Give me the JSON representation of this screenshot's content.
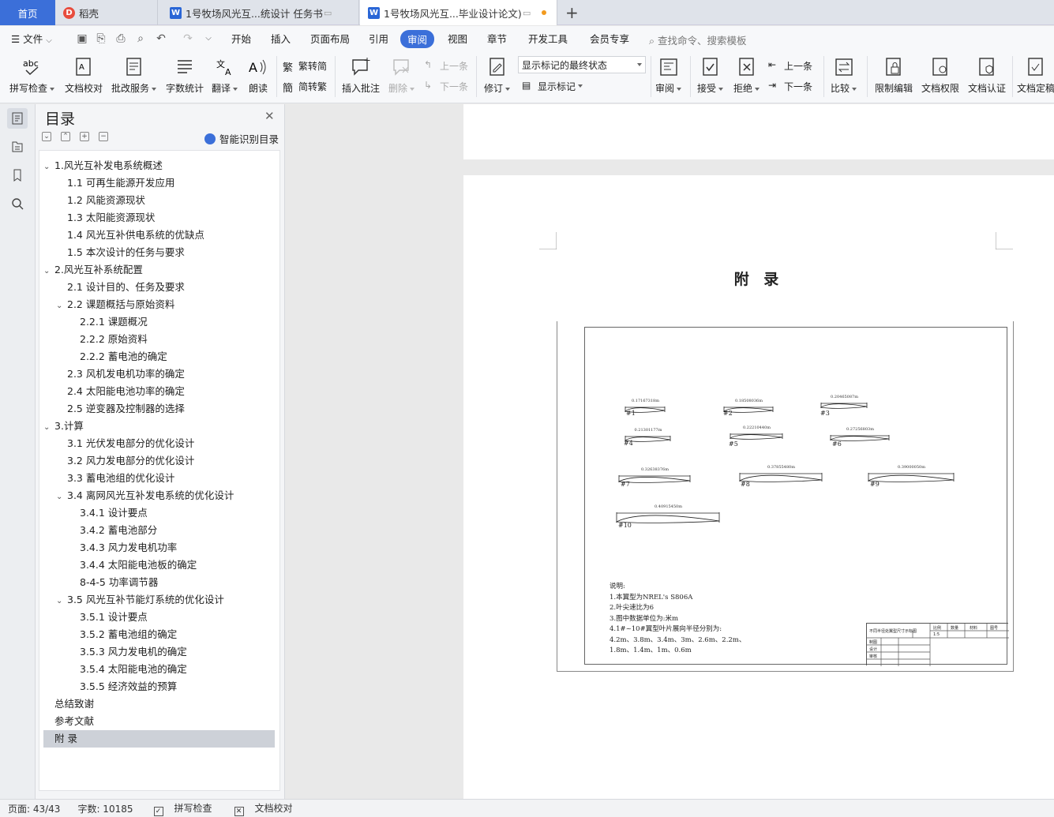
{
  "tabs": {
    "home": "首页",
    "daoke": "稻壳",
    "doc1": "1号牧场风光互...统设计 任务书",
    "doc2": "1号牧场风光互...毕业设计论文)",
    "new_tab": "+"
  },
  "menu": {
    "file": "文件",
    "items": [
      "开始",
      "插入",
      "页面布局",
      "引用",
      "审阅",
      "视图",
      "章节",
      "开发工具",
      "会员专享"
    ],
    "active": "审阅",
    "search": "查找命令、搜索模板"
  },
  "ribbon": {
    "spell_check": "拼写检查",
    "doc_proof": "文档校对",
    "batch_service": "批改服务",
    "word_count": "字数统计",
    "translate": "翻译",
    "read_aloud": "朗读",
    "trad_to_simp": "繁转简",
    "simp_to_trad": "简转繁",
    "insert_comment": "插入批注",
    "delete": "删除",
    "prev_comment": "上一条",
    "next_comment": "下一条",
    "track_changes": "修订",
    "markup_state": "显示标记的最终状态",
    "show_markup": "显示标记",
    "review": "审阅",
    "accept": "接受",
    "reject": "拒绝",
    "prev": "上一条",
    "next": "下一条",
    "compare": "比较",
    "restrict_edit": "限制编辑",
    "doc_permission": "文档权限",
    "doc_auth": "文档认证",
    "doc_final": "文档定稿"
  },
  "toc": {
    "title": "目录",
    "smart": "智能识别目录",
    "items": [
      {
        "text": "1.风光互补发电系统概述",
        "level": 1,
        "expand": true
      },
      {
        "text": "1.1  可再生能源开发应用",
        "level": 2
      },
      {
        "text": "1.2  风能资源现状",
        "level": 2
      },
      {
        "text": "1.3  太阳能资源现状",
        "level": 2
      },
      {
        "text": "1.4  风光互补供电系统的优缺点",
        "level": 2
      },
      {
        "text": "1.5 本次设计的任务与要求",
        "level": 2
      },
      {
        "text": "2.风光互补系统配置",
        "level": 1,
        "expand": true
      },
      {
        "text": "2.1 设计目的、任务及要求",
        "level": 2
      },
      {
        "text": "2.2 课题概括与原始资料",
        "level": 2,
        "expand": true
      },
      {
        "text": "2.2.1 课题概况",
        "level": 3
      },
      {
        "text": "2.2.2 原始资料",
        "level": 3
      },
      {
        "text": "2.2.2 蓄电池的确定",
        "level": 3
      },
      {
        "text": "2.3 风机发电机功率的确定",
        "level": 2
      },
      {
        "text": "2.4 太阳能电池功率的确定",
        "level": 2
      },
      {
        "text": "2.5 逆变器及控制器的选择",
        "level": 2
      },
      {
        "text": "3.计算",
        "level": 1,
        "expand": true
      },
      {
        "text": "3.1 光伏发电部分的优化设计",
        "level": 2
      },
      {
        "text": "3.2 风力发电部分的优化设计",
        "level": 2
      },
      {
        "text": "3.3 蓄电池组的优化设计",
        "level": 2
      },
      {
        "text": "3.4  离网风光互补发电系统的优化设计",
        "level": 2,
        "expand": true
      },
      {
        "text": "3.4.1 设计要点",
        "level": 3
      },
      {
        "text": "3.4.2 蓄电池部分",
        "level": 3
      },
      {
        "text": "3.4.3 风力发电机功率",
        "level": 3
      },
      {
        "text": "3.4.4 太阳能电池板的确定",
        "level": 3
      },
      {
        "text": "8-4-5 功率调节器",
        "level": 3
      },
      {
        "text": "3.5  风光互补节能灯系统的优化设计",
        "level": 2,
        "expand": true
      },
      {
        "text": "3.5.1 设计要点",
        "level": 3
      },
      {
        "text": "3.5.2 蓄电池组的确定",
        "level": 3
      },
      {
        "text": "3.5.3 风力发电机的确定",
        "level": 3
      },
      {
        "text": "3.5.4 太阳能电池的确定",
        "level": 3
      },
      {
        "text": "3.5.5 经济效益的预算",
        "level": 3
      },
      {
        "text": "总结致谢",
        "level": 1
      },
      {
        "text": "参考文献",
        "level": 1
      },
      {
        "text": "附  录",
        "level": 1,
        "selected": true
      }
    ]
  },
  "document": {
    "title": "附 录",
    "blades": [
      {
        "label": "#1",
        "dim": "0.17167318m"
      },
      {
        "label": "#2",
        "dim": "0.18508036m"
      },
      {
        "label": "#3",
        "dim": "0.20465087m"
      },
      {
        "label": "#4",
        "dim": "0.21301177m"
      },
      {
        "label": "#5",
        "dim": "0.22210440m"
      },
      {
        "label": "#6",
        "dim": "0.27256803m"
      },
      {
        "label": "#7",
        "dim": "0.32638376m"
      },
      {
        "label": "#8",
        "dim": "0.37855480m"
      },
      {
        "label": "#9",
        "dim": "0.39000050m"
      },
      {
        "label": "#10",
        "dim": "0.40915450m"
      }
    ],
    "notes": "说明:\n1.本翼型为NREL's S806A\n2.叶尖速比为6\n3.图中数据单位为:米m\n4.1#~10#翼型叶片展向半径分别为:\n4.2m、3.8m、3.4m、3m、2.6m、2.2m、\n1.8m、1.4m、1m、0.6m",
    "titleblock": {
      "name": "不同半径处翼型尺寸示标图",
      "scale_h": "比例",
      "qty_h": "数量",
      "material_h": "材料",
      "drawing_no_h": "图号",
      "scale": "1:5",
      "draw": "制图",
      "design": "设计",
      "check": "审核"
    }
  },
  "status": {
    "page": "页面: 43/43",
    "words": "字数: 10185",
    "spell": "拼写检查",
    "proof": "文档校对"
  },
  "colors": {
    "accent": "#3b6fd9",
    "tab_bg": "#dfe3ea"
  }
}
